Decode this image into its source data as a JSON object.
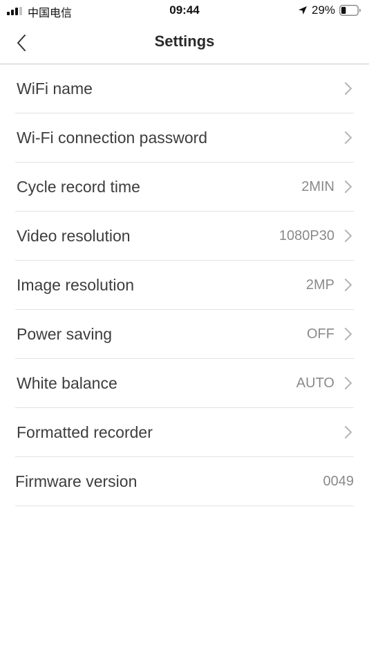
{
  "status_bar": {
    "carrier": "中国电信",
    "time": "09:44",
    "battery_percent": "29%",
    "battery_level": 0.29,
    "signal_bars": 3,
    "icons": [
      "signal-icon",
      "location-arrow-icon",
      "battery-icon"
    ]
  },
  "nav": {
    "title": "Settings",
    "back_icon": "chevron-left-icon"
  },
  "settings": [
    {
      "label": "WiFi name",
      "value": "",
      "chevron": true
    },
    {
      "label": "Wi-Fi connection password",
      "value": "",
      "chevron": true
    },
    {
      "label": "Cycle record time",
      "value": "2MIN",
      "chevron": true
    },
    {
      "label": "Video resolution",
      "value": "1080P30",
      "chevron": true
    },
    {
      "label": "Image resolution",
      "value": "2MP",
      "chevron": true
    },
    {
      "label": "Power saving",
      "value": "OFF",
      "chevron": true
    },
    {
      "label": "White balance",
      "value": "AUTO",
      "chevron": true
    },
    {
      "label": "Formatted recorder",
      "value": "",
      "chevron": true
    },
    {
      "label": "Firmware version",
      "value": "0049",
      "chevron": false
    }
  ],
  "colors": {
    "background": "#ffffff",
    "label_text": "#3d3d3d",
    "value_text": "#8a8a8a",
    "divider": "#e2e2e2",
    "chevron": "#b5b5b5"
  }
}
